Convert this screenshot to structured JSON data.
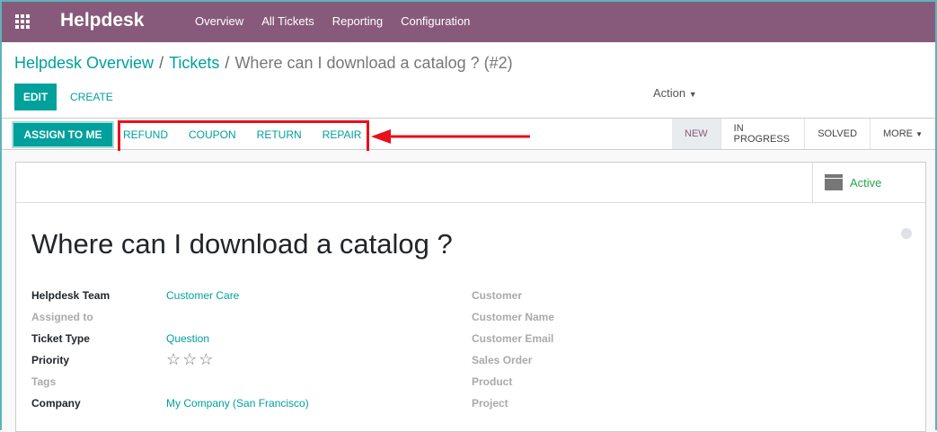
{
  "nav": {
    "brand": "Helpdesk",
    "menu": [
      "Overview",
      "All Tickets",
      "Reporting",
      "Configuration"
    ]
  },
  "breadcrumb": {
    "items": [
      "Helpdesk Overview",
      "Tickets"
    ],
    "current": "Where can I download a catalog ? (#2)"
  },
  "controls": {
    "edit": "EDIT",
    "create": "CREATE",
    "action": "Action"
  },
  "statusbar": {
    "assign": "ASSIGN TO ME",
    "buttons": [
      "REFUND",
      "COUPON",
      "RETURN",
      "REPAIR"
    ],
    "stages": [
      "NEW",
      "IN PROGRESS",
      "SOLVED",
      "MORE"
    ],
    "active_stage": "NEW"
  },
  "sheet": {
    "status": "Active",
    "title": "Where can I download a catalog ?",
    "left": [
      {
        "label": "Helpdesk Team",
        "value": "Customer Care"
      },
      {
        "label": "Assigned to",
        "value": ""
      },
      {
        "label": "Ticket Type",
        "value": "Question"
      },
      {
        "label": "Priority",
        "value": "☆☆☆"
      },
      {
        "label": "Tags",
        "value": ""
      },
      {
        "label": "Company",
        "value": "My Company (San Francisco)"
      }
    ],
    "right": [
      "Customer",
      "Customer Name",
      "Customer Email",
      "Sales Order",
      "Product",
      "Project"
    ]
  },
  "priority_stars": 0,
  "colors": {
    "brand": "#875a7b",
    "accent": "#00a09d",
    "highlight": "#e8101a"
  }
}
